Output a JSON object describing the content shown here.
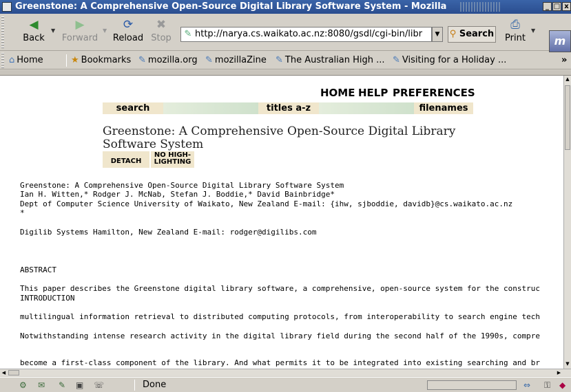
{
  "window": {
    "title": "Greenstone: A Comprehensive Open-Source Digital Library Software System - Mozilla",
    "minimize": "_",
    "maximize": "□",
    "close": "x"
  },
  "toolbar": {
    "back_label": "Back",
    "forward_label": "Forward",
    "reload_label": "Reload",
    "stop_label": "Stop",
    "url": "http://narya.cs.waikato.ac.nz:8080/gsdl/cgi-bin/libr",
    "search_label": "Search",
    "print_label": "Print",
    "logo_text": "m"
  },
  "personal_toolbar": {
    "items": [
      {
        "label": "Home"
      },
      {
        "label": "Bookmarks"
      },
      {
        "label": "mozilla.org"
      },
      {
        "label": "mozillaZine"
      },
      {
        "label": "The Australian High ..."
      },
      {
        "label": "Visiting for a Holiday ..."
      }
    ],
    "more": "»"
  },
  "page": {
    "nav": {
      "home": "HOME",
      "help": "HELP",
      "preferences": "PREFERENCES"
    },
    "tabs": {
      "search": "search",
      "titles": "titles a-z",
      "filenames": "filenames"
    },
    "doc_title": "Greenstone: A Comprehensive Open-Source Digital Library Software System",
    "detach": "DETACH",
    "no_highlighting": "NO HIGH-\nLIGHTING",
    "lines": [
      "Greenstone: A Comprehensive Open-Source Digital Library Software System",
      "Ian H. Witten,* Rodger J. McNab, Stefan J. Boddie,* David Bainbridge*",
      "Dept of Computer Science University of Waikato, New Zealand E-mail: {ihw, sjboddie, davidb}@cs.waikato.ac.nz",
      "*",
      "Digilib Systems Hamilton, New Zealand E-mail: rodger@digilibs.com",
      "ABSTRACT",
      "This paper describes the Greenstone digital library software, a comprehensive, open-source system for the construc",
      "INTRODUCTION",
      "multilingual information retrieval to distributed computing protocols, from interoperability to search engine tech",
      "Notwithstanding intense research activity in the digital library field during the second half of the 1990s, compre",
      "become a first-class component of the library. And what permits it to be integrated into existing searching and br"
    ]
  },
  "status": {
    "text": "Done"
  },
  "icons": {
    "back": "back-arrow-icon",
    "forward": "forward-arrow-icon",
    "reload": "reload-icon",
    "stop": "stop-icon",
    "print": "printer-icon",
    "search": "search-icon",
    "home": "home-icon",
    "bookmarks": "bookmarks-icon"
  }
}
